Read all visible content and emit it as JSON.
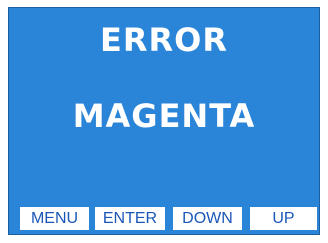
{
  "display": {
    "line1": "ERROR",
    "line2": "MAGENTA"
  },
  "softkeys": {
    "menu": "MENU",
    "enter": "ENTER",
    "down": "DOWN",
    "up": "UP"
  },
  "colors": {
    "screen_background": "#2a85d8",
    "text": "#ffffff",
    "key_background": "#ffffff",
    "key_text": "#1a57b8"
  }
}
